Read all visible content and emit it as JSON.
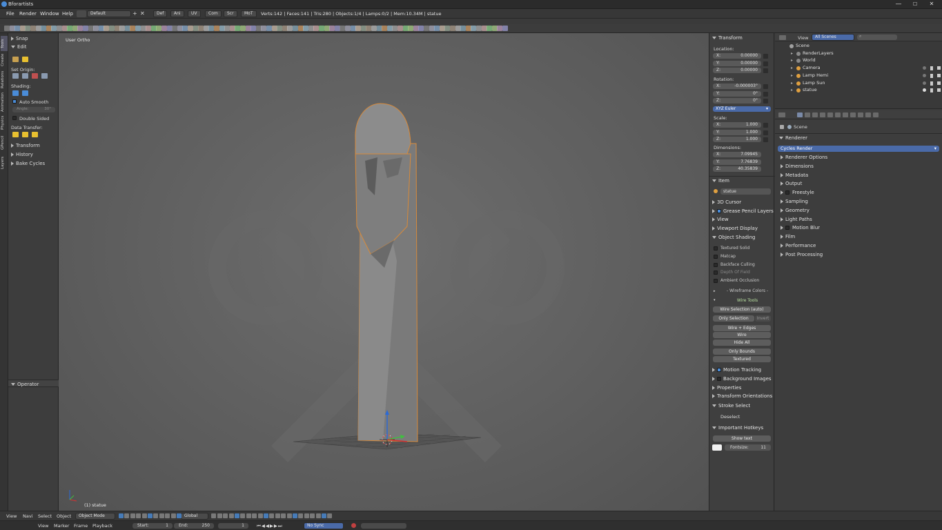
{
  "window": {
    "title": "Bforartists",
    "minimize": "—",
    "maximize": "☐",
    "close": "✕"
  },
  "menu": {
    "items": [
      "File",
      "Render",
      "Window",
      "Help"
    ],
    "screen_layout": "Default",
    "tabs": [
      "Def",
      "Ani",
      "UV",
      "Com",
      "Scr",
      "MoT"
    ],
    "stats": "Verts:142 | Faces:141 | Tris:280 | Objects:1/4 | Lamps:0/2 | Mem:10.34M | statue"
  },
  "left_tabs": [
    "Tools",
    "Create",
    "Relations",
    "Animation",
    "Physics",
    "GPencil",
    "Layers"
  ],
  "toolshelf": {
    "snap": "Snap",
    "edit": "Edit",
    "set_origin": "Set Origin:",
    "shading": "Shading:",
    "auto_smooth": "Auto Smooth",
    "angle_label": "Angle:",
    "angle_value": "30°",
    "double_sided": "Double Sided",
    "data_transfer": "Data Transfer:",
    "transform": "Transform",
    "history": "History",
    "bake_cycles": "Bake Cycles",
    "operator": "Operator"
  },
  "viewport": {
    "view_name": "User Ortho",
    "object_label": "(1) statue"
  },
  "npanel": {
    "transform": "Transform",
    "location_label": "Location:",
    "location": [
      {
        "axis": "X:",
        "value": "0.00000"
      },
      {
        "axis": "Y:",
        "value": "0.00000"
      },
      {
        "axis": "Z:",
        "value": "0.00000"
      }
    ],
    "rotation_label": "Rotation:",
    "rotation": [
      {
        "axis": "X:",
        "value": "-0.000003°"
      },
      {
        "axis": "Y:",
        "value": "0°"
      },
      {
        "axis": "Z:",
        "value": "0°"
      }
    ],
    "rotation_mode": "XYZ Euler",
    "scale_label": "Scale:",
    "scale": [
      {
        "axis": "X:",
        "value": "1.000"
      },
      {
        "axis": "Y:",
        "value": "1.000"
      },
      {
        "axis": "Z:",
        "value": "1.000"
      }
    ],
    "dimensions_label": "Dimensions:",
    "dimensions": [
      {
        "axis": "X:",
        "value": "7.09945"
      },
      {
        "axis": "Y:",
        "value": "7.76839"
      },
      {
        "axis": "Z:",
        "value": "40.35839"
      }
    ],
    "item": "Item",
    "item_name": "statue",
    "panels_a": [
      "3D Cursor",
      "Grease Pencil Layers",
      "View",
      "Viewport Display"
    ],
    "object_shading": "Object Shading",
    "shading_opts": [
      "Textured Solid",
      "Matcap",
      "Backface Culling",
      "Depth Of Field",
      "Ambient Occlusion"
    ],
    "wireframe_colors": "- Wireframe Colors -",
    "wire_tools": "Wire Tools",
    "wire_selection": "Wire Selection (auto)",
    "only_selection": "Only Selection",
    "invert": "Invert",
    "wire_edges": "Wire + Edges",
    "wire": "Wire",
    "hide_all": "Hide All",
    "only_bounds": "Only Bounds",
    "textured": "Textured",
    "panels_b": [
      "Motion Tracking",
      "Background Images",
      "Properties",
      "Transform Orientations"
    ],
    "stroke_select": "Stroke Select",
    "deselect": "Deselect",
    "important_hotkeys": "Important Hotkeys",
    "show_text": "Show text",
    "fontsize_label": "Fontsize:",
    "fontsize_value": "11"
  },
  "outliner": {
    "view": "View",
    "scenes": "All Scenes",
    "items": [
      {
        "name": "Scene",
        "indent": 0,
        "color": "#a0a0a0"
      },
      {
        "name": "RenderLayers",
        "indent": 1,
        "color": "#8a8a8a"
      },
      {
        "name": "World",
        "indent": 1,
        "color": "#8a8a8a"
      },
      {
        "name": "Camera",
        "indent": 1,
        "color": "#e0a040"
      },
      {
        "name": "Lamp Hemi",
        "indent": 1,
        "color": "#e0a040"
      },
      {
        "name": "Lamp Sun",
        "indent": 1,
        "color": "#e0a040"
      },
      {
        "name": "statue",
        "indent": 1,
        "color": "#e0a040"
      }
    ]
  },
  "properties": {
    "scene": "Scene",
    "renderer": "Renderer",
    "engine": "Cycles Render",
    "sections": [
      "Renderer Options",
      "Dimensions",
      "Metadata",
      "Output",
      "Freestyle",
      "Sampling",
      "Geometry",
      "Light Paths",
      "Motion Blur",
      "Film",
      "Performance",
      "Post Processing"
    ]
  },
  "timeline": {
    "items": [
      "View",
      "Navi",
      "Select",
      "Object"
    ],
    "mode": "Object Mode",
    "orientation": "Global"
  },
  "bottom": {
    "items": [
      "View",
      "Marker",
      "Frame",
      "Playback"
    ],
    "start_label": "Start:",
    "start": "1",
    "end_label": "End:",
    "end": "250",
    "current": "1",
    "sync": "No Sync"
  }
}
